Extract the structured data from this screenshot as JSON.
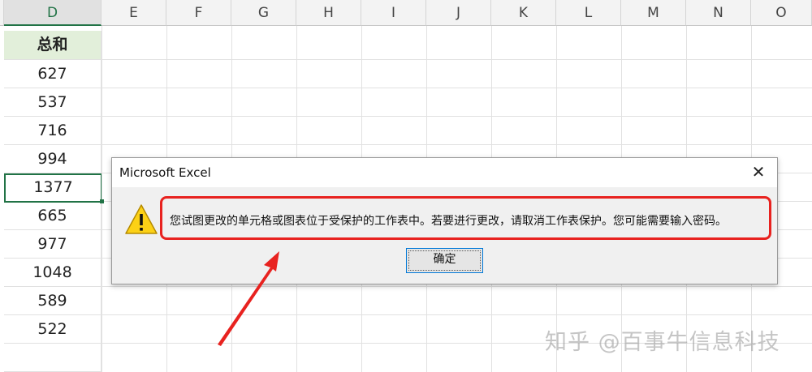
{
  "spreadsheet": {
    "columns": [
      "D",
      "E",
      "F",
      "G",
      "H",
      "I",
      "J",
      "K",
      "L",
      "M",
      "N",
      "O"
    ],
    "selected_column": "D",
    "header_cell": "总和",
    "values": [
      "627",
      "537",
      "716",
      "994",
      "1377",
      "665",
      "977",
      "1048",
      "589",
      "522"
    ],
    "active_value": "1377"
  },
  "dialog": {
    "title": "Microsoft Excel",
    "close_symbol": "✕",
    "message": "您试图更改的单元格或图表位于受保护的工作表中。若要进行更改，请取消工作表保护。您可能需要输入密码。",
    "ok_label": "确定",
    "icon": "warning-icon",
    "highlight_color": "#e8221f"
  },
  "watermark": "知乎 @百事牛信息科技",
  "colors": {
    "excel_green": "#217346",
    "header_fill": "#e2efda",
    "annotation_red": "#e8221f"
  }
}
